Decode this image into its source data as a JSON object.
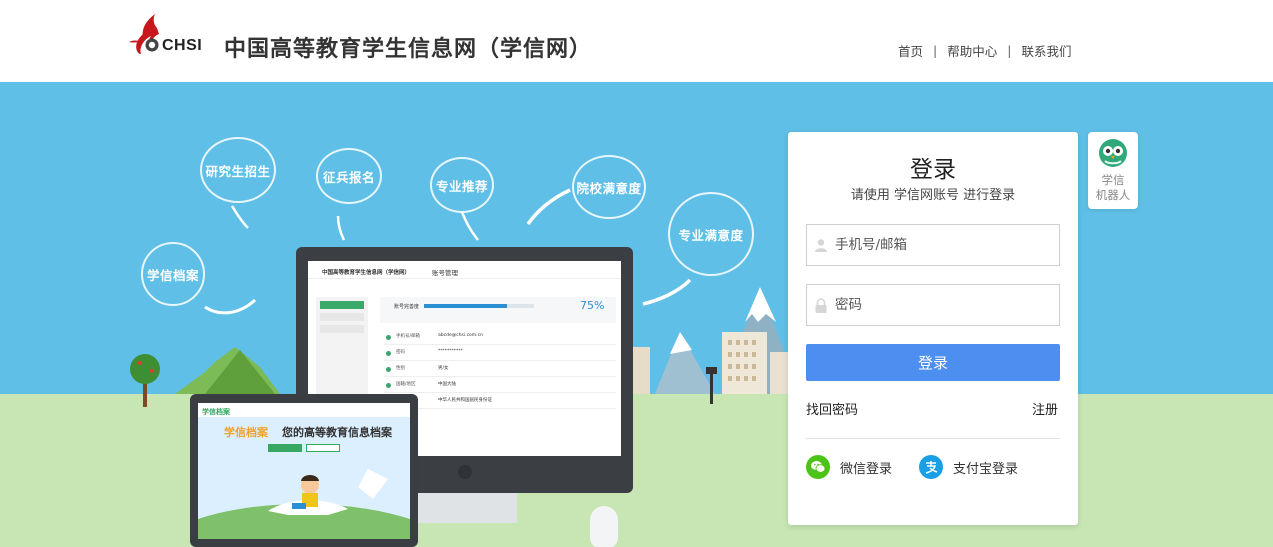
{
  "header": {
    "logo_text": "CHSI",
    "site_title": "中国高等教育学生信息网（学信网）",
    "nav": [
      {
        "label": "首页"
      },
      {
        "label": "帮助中心"
      },
      {
        "label": "联系我们"
      }
    ]
  },
  "hero": {
    "bubbles": [
      "学信档案",
      "研究生招生",
      "征兵报名",
      "专业推荐",
      "院校满意度",
      "专业满意度"
    ],
    "monitor": {
      "header_title": "中国高等教育学生信息网（学信网）",
      "page_title": "账号管理",
      "progress_label": "账号完善度",
      "progress_percent": "75%",
      "progress_value": 0.75,
      "rows": [
        {
          "label": "手机号/邮箱",
          "value": "abcde@chsi.com.cn"
        },
        {
          "label": "密码",
          "value": "***********"
        },
        {
          "label": "性别",
          "value": "男/女"
        },
        {
          "label": "国籍/地区",
          "value": "中国大陆"
        },
        {
          "label": "证件号码",
          "value": "中华人民共和国居民身份证"
        }
      ]
    },
    "laptop": {
      "brand": "学信档案",
      "headline_accent": "学信档案",
      "headline": "您的高等教育信息档案"
    }
  },
  "login": {
    "title": "登录",
    "subtitle": "请使用  学信网账号  进行登录",
    "username_placeholder": "手机号/邮箱",
    "password_placeholder": "密码",
    "submit_label": "登录",
    "forgot_label": "找回密码",
    "register_label": "注册",
    "wechat_label": "微信登录",
    "alipay_label": "支付宝登录"
  },
  "robot": {
    "line1": "学信",
    "line2": "机器人"
  },
  "colors": {
    "hero_bg": "#5fbfe6",
    "ground": "#c7e6b4",
    "primary_button": "#4d8ff0",
    "wechat": "#4cc417",
    "alipay": "#1a9ee6",
    "logo_red": "#c8161d"
  }
}
